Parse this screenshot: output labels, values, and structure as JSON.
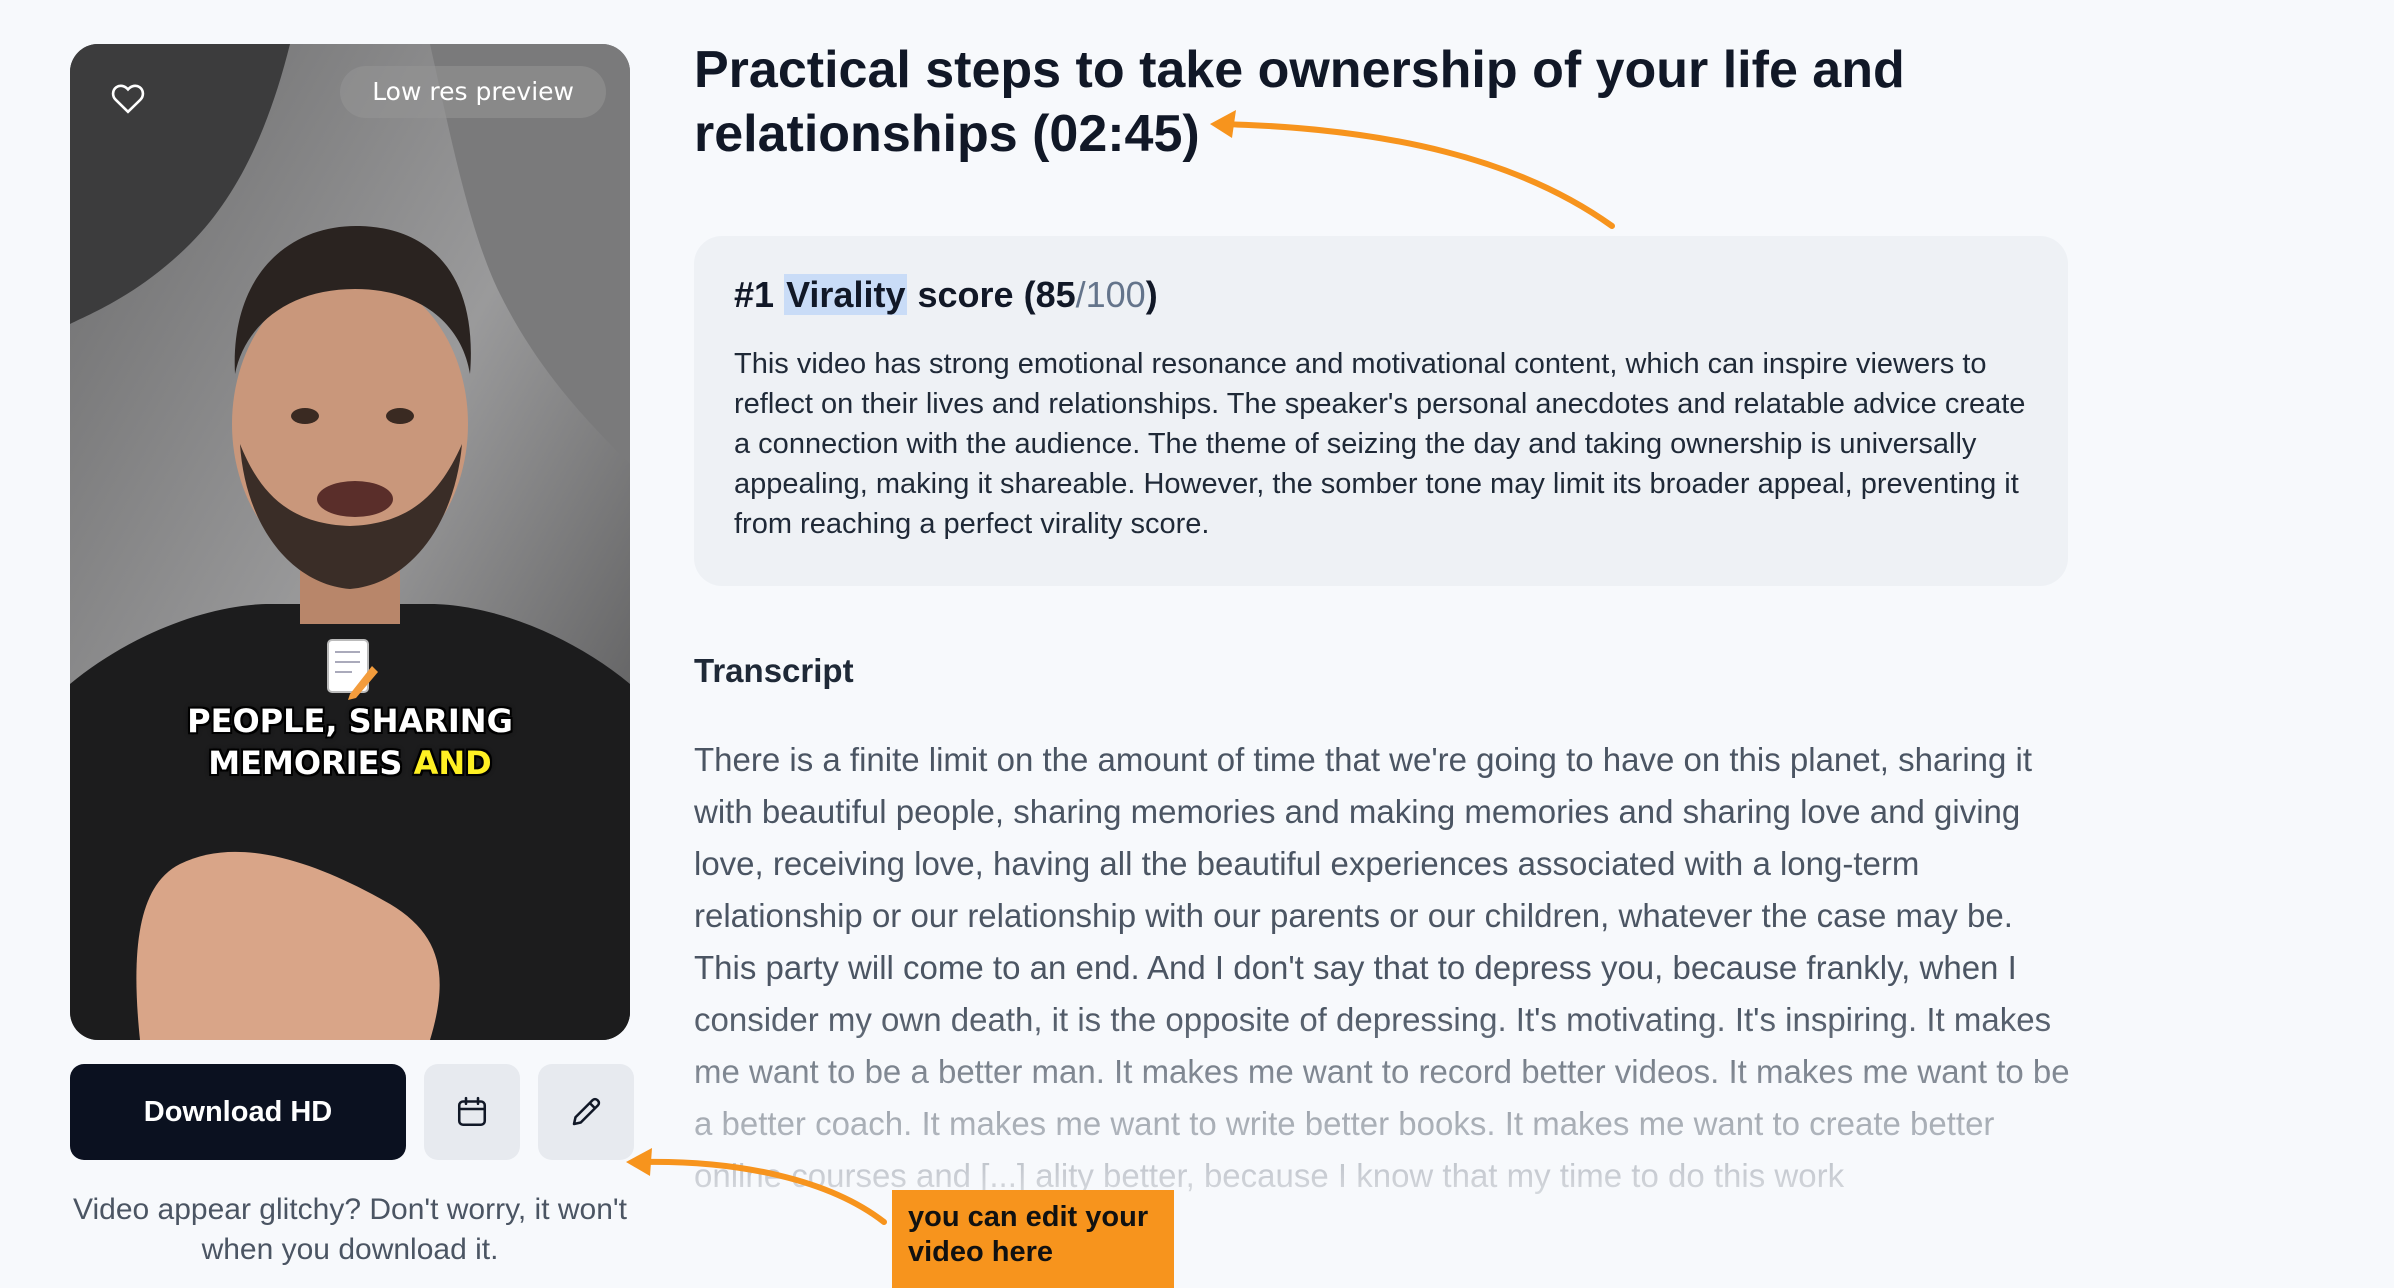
{
  "video": {
    "preview_badge": "Low res preview",
    "caption_line1": "PEOPLE, SHARING",
    "caption_line2_white": "MEMORIES",
    "caption_line2_yellow": "AND"
  },
  "actions": {
    "download_label": "Download HD",
    "schedule_icon": "calendar-icon",
    "edit_icon": "pencil-icon",
    "favorite_icon": "heart-icon"
  },
  "glitch_note": "Video appear glitchy? Don't worry, it won't when you download it.",
  "clip": {
    "title": "Practical steps to take ownership of your life and relationships (02:45)"
  },
  "virality": {
    "rank": "#1",
    "label": "Virality",
    "suffix": "score (",
    "score": "85",
    "max": "/100",
    "close": ")",
    "description": "This video has strong emotional resonance and motivational content, which can inspire viewers to reflect on their lives and relationships. The speaker's personal anecdotes and relatable advice create a connection with the audience. The theme of seizing the day and taking ownership is universally appealing, making it shareable. However, the somber tone may limit its broader appeal, preventing it from reaching a perfect virality score."
  },
  "transcript": {
    "heading": "Transcript",
    "text": "There is a finite limit on the amount of time that we're going to have on this planet, sharing it with beautiful people, sharing memories and making memories and sharing love and giving love, receiving love, having all the beautiful experiences associated with a long-term relationship or our relationship with our parents or our children, whatever the case may be. This party will come to an end. And I don't say that to depress you, because frankly, when I consider my own death, it is the opposite of depressing. It's motivating. It's inspiring. It makes me want to be a better man. It makes me want to record better videos. It makes me want to be a better coach. It makes me want to write better books. It makes me want to create better online courses and [...] ality better, because I know that my time to do this work"
  },
  "annotation": {
    "callout": "you can edit your video here",
    "accent_color": "#f7941d"
  },
  "colors": {
    "background": "#f7f9fc",
    "primary_button": "#0b1120",
    "card": "#eef1f5",
    "caption_highlight": "#fff023"
  }
}
